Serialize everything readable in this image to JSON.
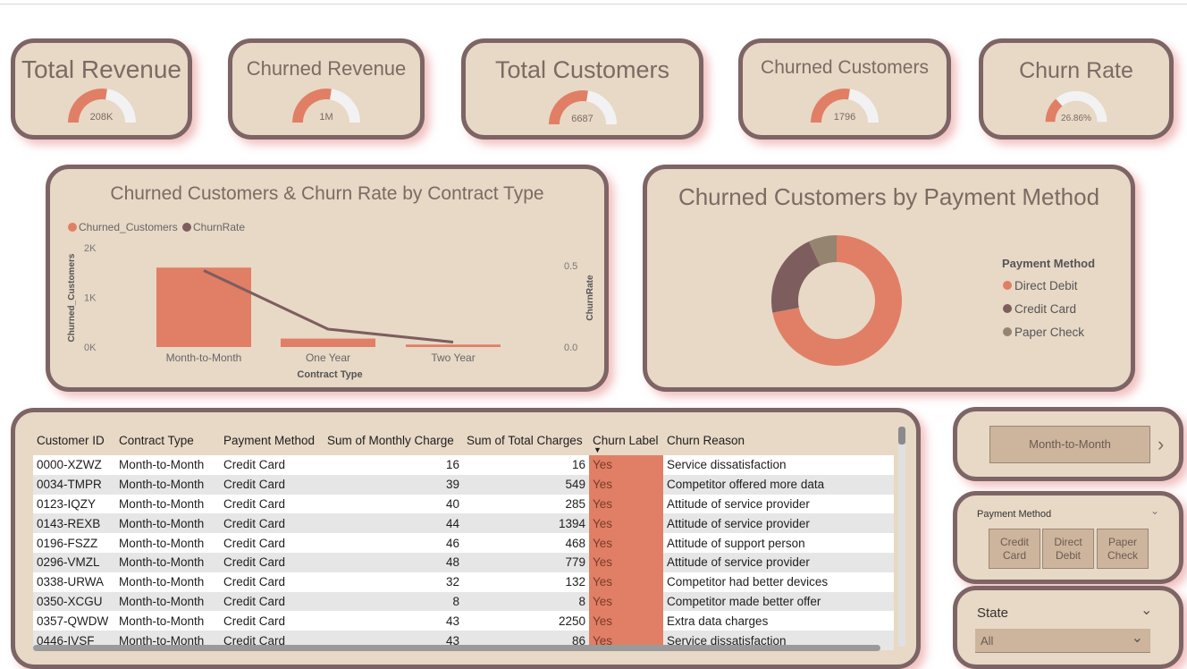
{
  "kpis": [
    {
      "title": "Total Revenue",
      "value": "208K",
      "fraction": 0.55
    },
    {
      "title": "Churned Revenue",
      "value": "1M",
      "fraction": 0.55
    },
    {
      "title": "Total Customers",
      "value": "6687",
      "fraction": 0.55
    },
    {
      "title": "Churned Customers",
      "value": "1796",
      "fraction": 0.55
    },
    {
      "title": "Churn Rate",
      "value": "26.86%",
      "fraction": 0.27
    }
  ],
  "colors": {
    "churned": "#e07f65",
    "churnrate": "#7d5d5e",
    "paper": "#958470",
    "card_bg": "#e8d8c6",
    "card_border": "#7d6465",
    "gauge_empty": "#f2f2f2"
  },
  "contract_chart": {
    "title": "Churned Customers & Churn Rate by Contract Type",
    "legend": [
      "Churned_Customers",
      "ChurnRate"
    ]
  },
  "chart_data": [
    {
      "type": "bar",
      "title": "Churned Customers & Churn Rate by Contract Type",
      "categories": [
        "Month-to-Month",
        "One Year",
        "Two Year"
      ],
      "series": [
        {
          "name": "Churned_Customers",
          "type": "bar",
          "axis": "left",
          "values": [
            1600,
            170,
            50
          ]
        },
        {
          "name": "ChurnRate",
          "type": "line",
          "axis": "right",
          "values": [
            0.47,
            0.11,
            0.03
          ]
        }
      ],
      "xlabel": "Contract Type",
      "ylabel": "Churned_Customers",
      "y2label": "ChurnRate",
      "ylim": [
        0,
        2000
      ],
      "y2lim": [
        0,
        0.5
      ],
      "yticks": [
        "0K",
        "1K",
        "2K"
      ],
      "y2ticks": [
        "0.0",
        "0.5"
      ],
      "legend_position": "top-left"
    },
    {
      "type": "pie",
      "title": "Churned Customers by Payment Method",
      "legend_title": "Payment Method",
      "categories": [
        "Direct Debit",
        "Credit Card",
        "Paper Check"
      ],
      "values": [
        0.72,
        0.21,
        0.07
      ],
      "colors": [
        "#e07f65",
        "#7d5d5e",
        "#958470"
      ],
      "legend_position": "right"
    }
  ],
  "table": {
    "headers": [
      "Customer ID",
      "Contract Type",
      "Payment Method",
      "Sum of Monthly Charge",
      "Sum of Total Charges",
      "Churn Label",
      "Churn Reason"
    ],
    "rows": [
      [
        "0000-XZWZ",
        "Month-to-Month",
        "Credit Card",
        "16",
        "16",
        "Yes",
        "Service dissatisfaction"
      ],
      [
        "0034-TMPR",
        "Month-to-Month",
        "Credit Card",
        "39",
        "549",
        "Yes",
        "Competitor offered more data"
      ],
      [
        "0123-IQZY",
        "Month-to-Month",
        "Credit Card",
        "40",
        "285",
        "Yes",
        "Attitude of service provider"
      ],
      [
        "0143-REXB",
        "Month-to-Month",
        "Credit Card",
        "44",
        "1394",
        "Yes",
        "Attitude of service provider"
      ],
      [
        "0196-FSZZ",
        "Month-to-Month",
        "Credit Card",
        "46",
        "468",
        "Yes",
        "Attitude of support person"
      ],
      [
        "0296-VMZL",
        "Month-to-Month",
        "Credit Card",
        "48",
        "779",
        "Yes",
        "Attitude of service provider"
      ],
      [
        "0338-URWA",
        "Month-to-Month",
        "Credit Card",
        "32",
        "132",
        "Yes",
        "Competitor had better devices"
      ],
      [
        "0350-XCGU",
        "Month-to-Month",
        "Credit Card",
        "8",
        "8",
        "Yes",
        "Competitor made better offer"
      ],
      [
        "0357-QWDW",
        "Month-to-Month",
        "Credit Card",
        "43",
        "2250",
        "Yes",
        "Extra data charges"
      ],
      [
        "0446-IVSF",
        "Month-to-Month",
        "Credit Card",
        "43",
        "86",
        "Yes",
        "Service dissatisfaction"
      ]
    ]
  },
  "contract_slicer": {
    "selected": "Month-to-Month"
  },
  "payment_slicer": {
    "title": "Payment Method",
    "options": [
      [
        "Credit",
        "Card"
      ],
      [
        "Direct",
        "Debit"
      ],
      [
        "Paper",
        "Check"
      ]
    ]
  },
  "state_slicer": {
    "title": "State",
    "value": "All"
  }
}
